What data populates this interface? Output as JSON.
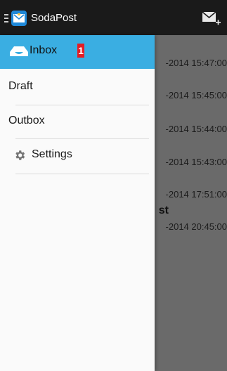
{
  "app": {
    "title": "SodaPost"
  },
  "drawer": {
    "items": [
      {
        "label": "Inbox",
        "badge": "1",
        "active": true
      },
      {
        "label": "Draft"
      },
      {
        "label": "Outbox"
      },
      {
        "label": "Settings"
      }
    ]
  },
  "messages": [
    {
      "time": "-2014 15:47:00"
    },
    {
      "time": "-2014 15:45:00"
    },
    {
      "time": "-2014 15:44:00"
    },
    {
      "time": "-2014 15:43:00"
    },
    {
      "time": "-2014 17:51:00",
      "subject": "st"
    },
    {
      "time": "-2014 20:45:00"
    }
  ],
  "colors": {
    "actionbar": "#1a1a1a",
    "active_item": "#3aaee2",
    "badge": "#e51c23",
    "app_icon": "#1e88d8"
  },
  "icons": {
    "compose": "compose-mail-icon",
    "inbox": "inbox-tray-icon",
    "settings": "gear-icon",
    "app": "app-logo-icon"
  }
}
